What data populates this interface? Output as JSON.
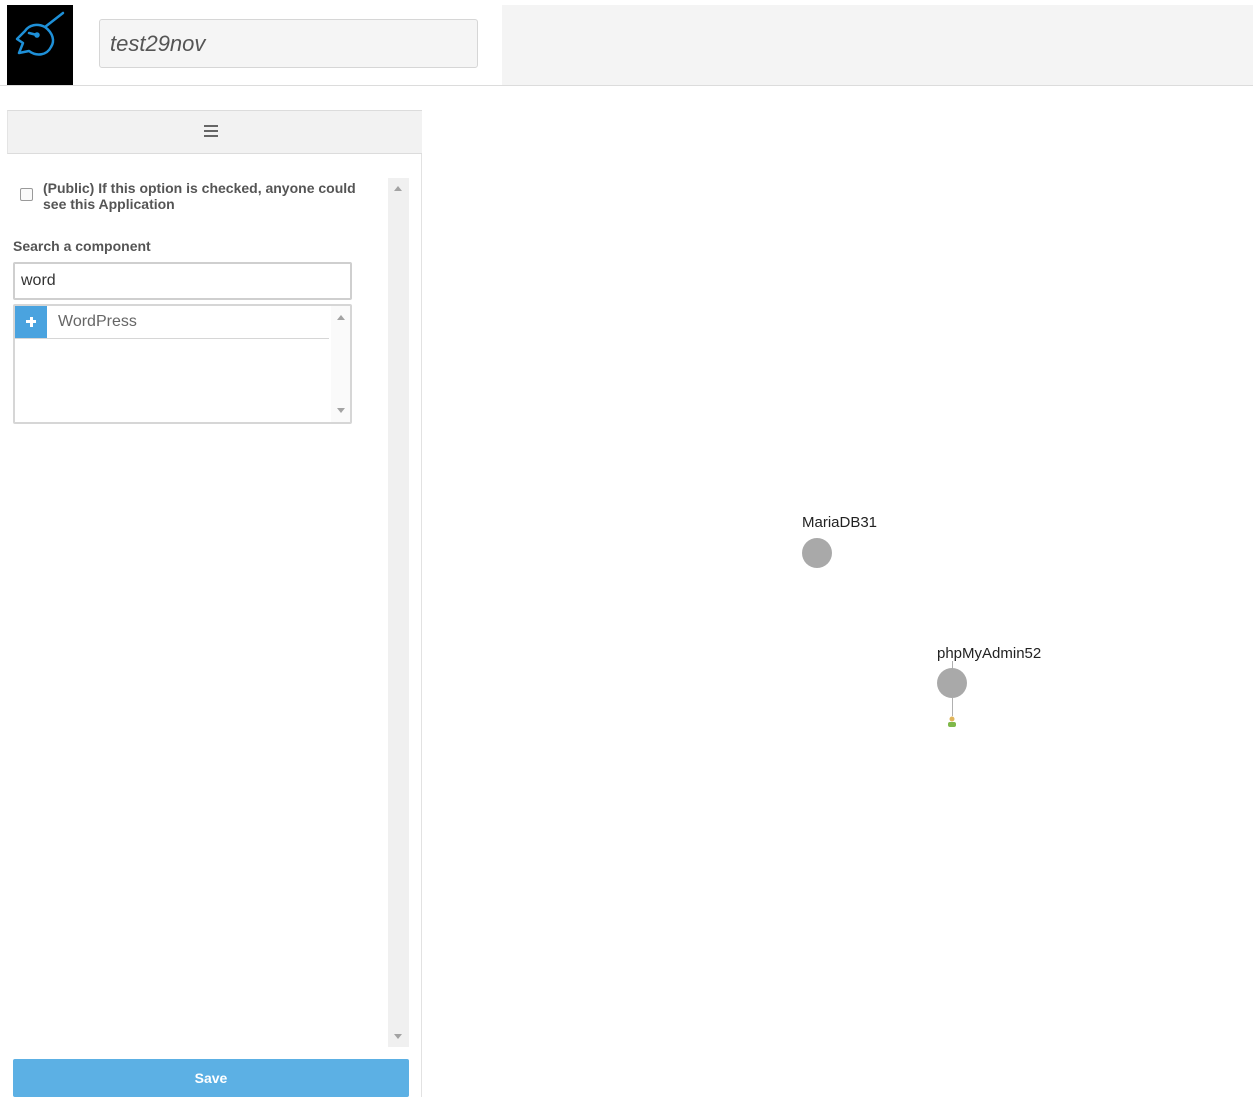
{
  "header": {
    "app_name_value": "test29nov",
    "logo_icon": "unicorn-logo"
  },
  "sidebar": {
    "menu_icon": "hamburger-menu-icon",
    "public_option_label": "(Public) If this option is checked, anyone could see this Application",
    "public_checked": false,
    "search_label": "Search a component",
    "search_value": "word",
    "results": [
      {
        "label": "WordPress",
        "icon": "plus-icon"
      }
    ],
    "save_label": "Save"
  },
  "canvas": {
    "nodes": [
      {
        "label": "MariaDB31"
      },
      {
        "label": "phpMyAdmin52"
      }
    ]
  },
  "colors": {
    "accent": "#4aa3df",
    "save_button": "#5cb0e4",
    "node": "#a9a9a9"
  }
}
